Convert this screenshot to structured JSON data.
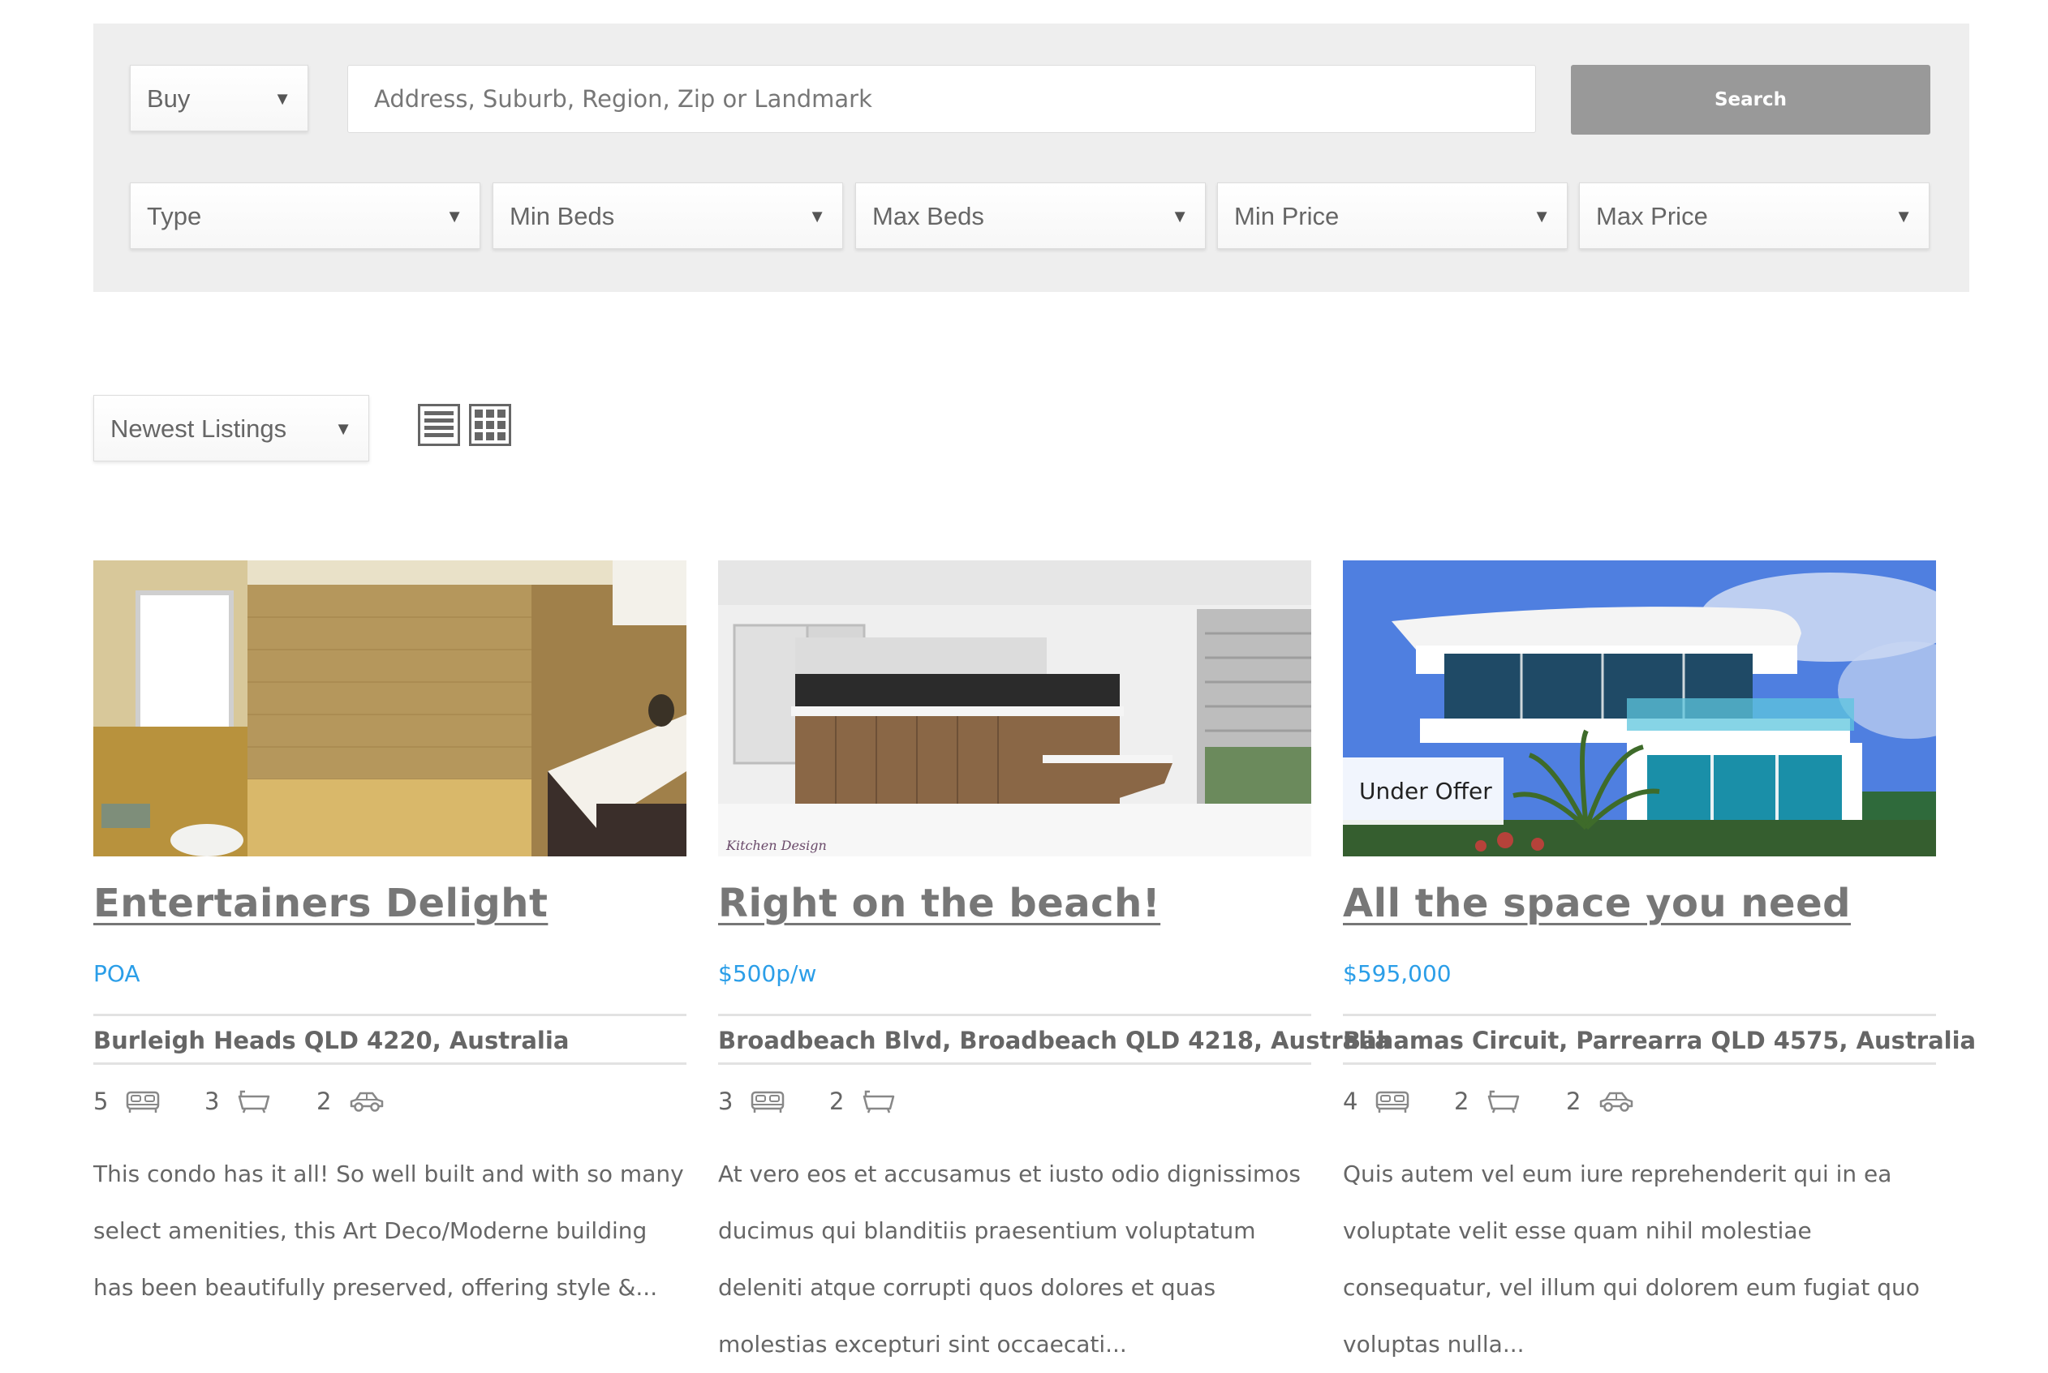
{
  "search": {
    "mode_selected": "Buy",
    "placeholder": "Address, Suburb, Region, Zip or Landmark",
    "button_label": "Search",
    "filters": [
      "Type",
      "Min Beds",
      "Max Beds",
      "Min Price",
      "Max Price"
    ]
  },
  "sort": {
    "selected": "Newest Listings"
  },
  "view_icons": [
    "list-view-icon",
    "grid-view-icon"
  ],
  "colors": {
    "panel": "#eeeeee",
    "button": "#999999",
    "price": "#2b9ee8",
    "title": "#777777"
  },
  "listings": [
    {
      "title": "Entertainers Delight",
      "price": "POA",
      "address": "Burleigh Heads QLD 4220, Australia",
      "beds": "5",
      "baths": "3",
      "cars": "2",
      "description": "This condo has it all! So well built and with so many select amenities, this Art Deco/Moderne building has been beautifully preserved, offering style &...",
      "image": "bathroom-photo",
      "badge": ""
    },
    {
      "title": "Right on the beach!",
      "price": "$500p/w",
      "address": "Broadbeach Blvd, Broadbeach QLD 4218, Australia",
      "beds": "3",
      "baths": "2",
      "cars": "",
      "description": "At vero eos et accusamus et iusto odio dignissimos ducimus qui blanditiis praesentium voluptatum deleniti atque corrupti quos dolores et quas molestias excepturi sint occaecati...",
      "image": "kitchen-photo",
      "image_caption": "Kitchen Design",
      "badge": ""
    },
    {
      "title": "All the space you need",
      "price": "$595,000",
      "address": "Bahamas Circuit, Parrearra QLD 4575, Australia",
      "beds": "4",
      "baths": "2",
      "cars": "2",
      "description": "Quis autem vel eum iure reprehenderit qui in ea voluptate velit esse quam nihil molestiae consequatur, vel illum qui dolorem eum fugiat quo voluptas nulla...",
      "image": "modern-house-photo",
      "badge": "Under Offer"
    }
  ]
}
